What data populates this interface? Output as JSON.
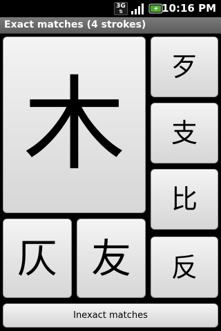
{
  "status_bar": {
    "network_label": "3G",
    "time": "10:16 PM",
    "icons": [
      "network-3g-icon",
      "signal-strength-icon",
      "battery-charging-icon"
    ],
    "battery_color": "#4caf2a"
  },
  "title_bar": {
    "title": "Exact matches (4 strokes)"
  },
  "matches": {
    "primary": "木",
    "secondary": [
      "仄",
      "友"
    ],
    "side": [
      "歹",
      "支",
      "比",
      "反"
    ]
  },
  "footer": {
    "inexact_label": "Inexact matches"
  }
}
